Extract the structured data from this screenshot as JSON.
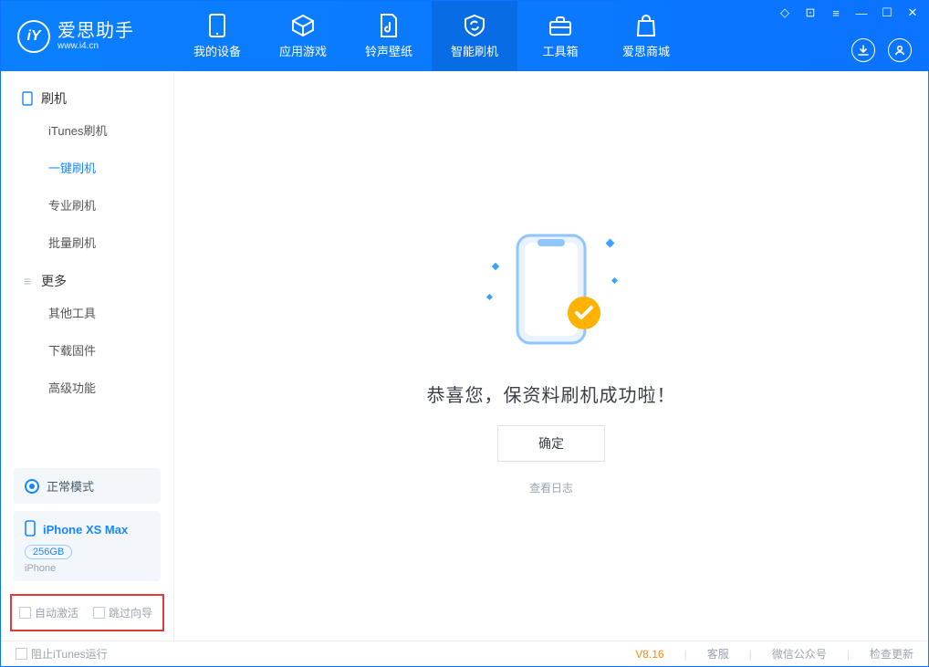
{
  "brand": {
    "name": "爱思助手",
    "url": "www.i4.cn",
    "logo_letter": "iY"
  },
  "tabs": [
    {
      "id": "device",
      "label": "我的设备"
    },
    {
      "id": "apps",
      "label": "应用游戏"
    },
    {
      "id": "ring",
      "label": "铃声壁纸"
    },
    {
      "id": "flash",
      "label": "智能刷机",
      "active": true
    },
    {
      "id": "toolbox",
      "label": "工具箱"
    },
    {
      "id": "store",
      "label": "爱思商城"
    }
  ],
  "sidebar": {
    "group_flash": "刷机",
    "group_more": "更多",
    "items": {
      "itunes": "iTunes刷机",
      "oneclick": "一键刷机",
      "pro": "专业刷机",
      "batch": "批量刷机",
      "other": "其他工具",
      "fw": "下载固件",
      "adv": "高级功能"
    }
  },
  "status_mode": "正常模式",
  "device": {
    "name": "iPhone XS Max",
    "storage": "256GB",
    "type": "iPhone"
  },
  "options": {
    "auto_activate": "自动激活",
    "skip_guide": "跳过向导"
  },
  "main": {
    "success_msg": "恭喜您，保资料刷机成功啦！",
    "ok_label": "确定",
    "log_link": "查看日志"
  },
  "footer": {
    "block_itunes": "阻止iTunes运行",
    "version": "V8.16",
    "support": "客服",
    "wechat": "微信公众号",
    "update": "检查更新"
  }
}
